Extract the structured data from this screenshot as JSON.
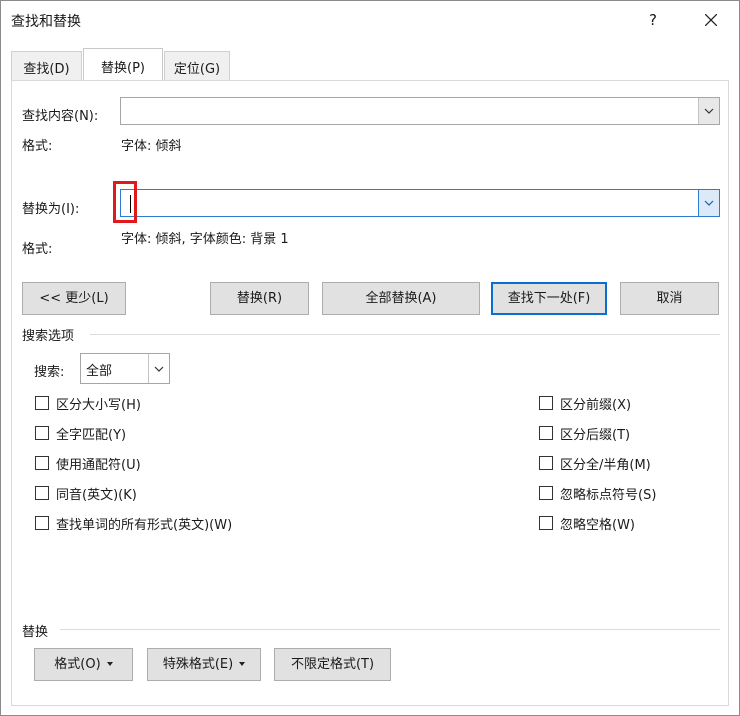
{
  "window": {
    "title": "查找和替换",
    "help_label": "?"
  },
  "tabs": [
    {
      "label": "查找(D)",
      "active": false
    },
    {
      "label": "替换(P)",
      "active": true
    },
    {
      "label": "定位(G)",
      "active": false
    }
  ],
  "find": {
    "label": "查找内容(N):",
    "value": "",
    "format_label": "格式:",
    "format_value": "字体: 倾斜"
  },
  "replace": {
    "label": "替换为(I):",
    "value": "",
    "format_label": "格式:",
    "format_value": "字体: 倾斜, 字体颜色: 背景 1"
  },
  "buttons": {
    "less": "<< 更少(L)",
    "replace": "替换(R)",
    "replace_all": "全部替换(A)",
    "find_next": "查找下一处(F)",
    "cancel": "取消"
  },
  "search_options": {
    "section_title": "搜索选项",
    "search_label": "搜索:",
    "search_value": "全部",
    "left_options": [
      {
        "label": "区分大小写(H)",
        "checked": false
      },
      {
        "label": "全字匹配(Y)",
        "checked": false
      },
      {
        "label": "使用通配符(U)",
        "checked": false
      },
      {
        "label": "同音(英文)(K)",
        "checked": false
      },
      {
        "label": "查找单词的所有形式(英文)(W)",
        "checked": false
      }
    ],
    "right_options": [
      {
        "label": "区分前缀(X)",
        "checked": false
      },
      {
        "label": "区分后缀(T)",
        "checked": false
      },
      {
        "label": "区分全/半角(M)",
        "checked": false
      },
      {
        "label": "忽略标点符号(S)",
        "checked": false
      },
      {
        "label": "忽略空格(W)",
        "checked": false
      }
    ]
  },
  "replace_section": {
    "title": "替换",
    "format_button": "格式(O)",
    "special_button": "特殊格式(E)",
    "no_format_button": "不限定格式(T)"
  },
  "colors": {
    "highlight_box": "#e0191c",
    "focus_blue": "#0b6fd1"
  }
}
